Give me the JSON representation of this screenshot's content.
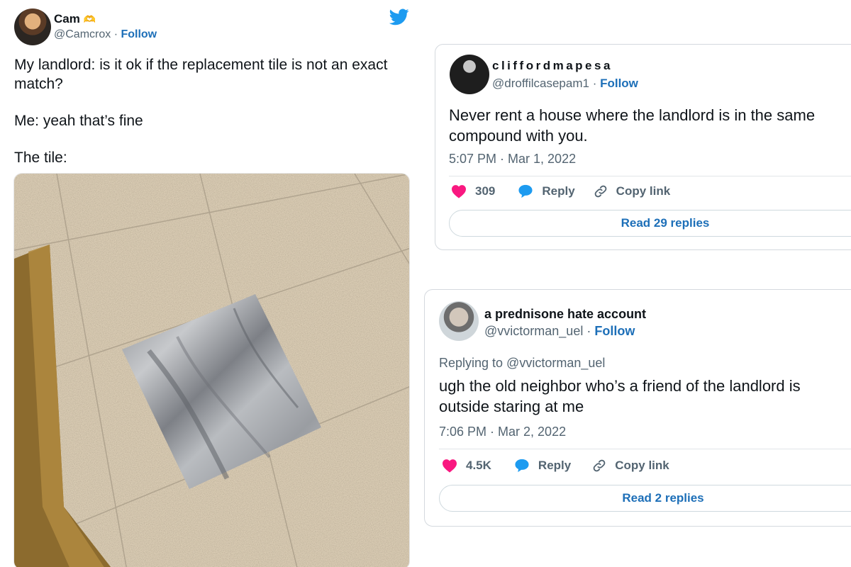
{
  "tweet_left": {
    "name": "Cam",
    "name_emoji": "🫶",
    "handle": "@Camcrox",
    "separator": " · ",
    "follow_label": "Follow",
    "text_lines": [
      "My landlord: is it ok if the replacement tile is not an exact",
      "match?",
      "Me: yeah that’s fine",
      "The tile:"
    ]
  },
  "tweet_r1": {
    "name": "cliffordmapesa",
    "handle": "@droffilcasepam1",
    "separator": " · ",
    "follow_label": "Follow",
    "text_lines": [
      "Never rent a house where the landlord is in the same",
      "compound with you."
    ],
    "timestamp": "5:07 PM · Mar 1, 2022",
    "like_count": "309",
    "reply_label": "Reply",
    "copy_link_label": "Copy link",
    "read_replies_label": "Read 29 replies"
  },
  "tweet_r2": {
    "name": "a prednisone hate account",
    "handle": "@vvictorman_uel",
    "separator": " · ",
    "follow_label": "Follow",
    "replying_to": "Replying to @vvictorman_uel",
    "text_lines": [
      "ugh the old neighbor who’s a friend of the landlord is",
      "outside staring at me"
    ],
    "timestamp": "7:06 PM · Mar 2, 2022",
    "like_count": "4.5K",
    "reply_label": "Reply",
    "copy_link_label": "Copy link",
    "read_replies_label": "Read 2 replies"
  },
  "colors": {
    "link_blue": "#1d6fb8",
    "twitter_blue": "#1d9bf0",
    "heart_pink": "#f91880",
    "muted_gray": "#536471"
  },
  "icons": [
    "twitter-bird-icon",
    "heart-icon",
    "reply-bubble-icon",
    "link-icon"
  ]
}
